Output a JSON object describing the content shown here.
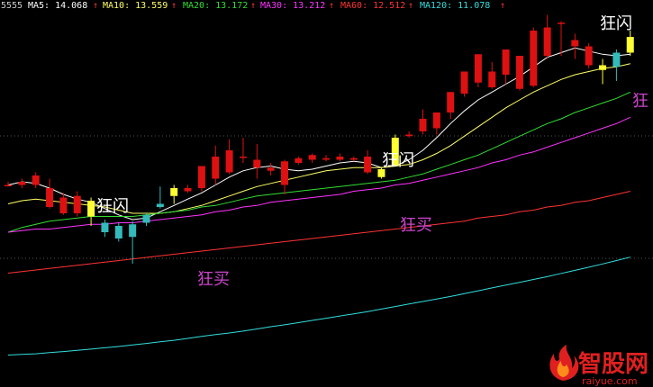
{
  "chart_data": {
    "type": "candlestick",
    "code": "5555",
    "moving_averages": [
      {
        "name": "MA5",
        "value": "14.068",
        "color": "#ffffff"
      },
      {
        "name": "MA10",
        "value": "13.559",
        "color": "#ffff66"
      },
      {
        "name": "MA20",
        "value": "13.172",
        "color": "#33dd33"
      },
      {
        "name": "MA30",
        "value": "13.212",
        "color": "#ff33ff"
      },
      {
        "name": "MA60",
        "value": "12.512",
        "color": "#ff3333"
      },
      {
        "name": "MA120",
        "value": "11.078",
        "color": "#33dddd"
      }
    ],
    "up_arrow": "↑",
    "colors": {
      "background": "#000000",
      "up": "#dd1111",
      "down": "#33bbbb",
      "signal": "#ffff33",
      "pink_annotation": "#cc44cc",
      "grid": "#555555"
    },
    "candles": [
      {
        "o": 10.0,
        "c": 10.0,
        "h": 10.1,
        "l": 9.95,
        "kind": "up"
      },
      {
        "o": 10.0,
        "c": 10.1,
        "h": 10.2,
        "l": 9.9,
        "kind": "up"
      },
      {
        "o": 10.3,
        "c": 10.0,
        "h": 10.4,
        "l": 9.9,
        "kind": "up"
      },
      {
        "o": 9.9,
        "c": 9.3,
        "h": 10.2,
        "l": 9.25,
        "kind": "up"
      },
      {
        "o": 9.6,
        "c": 9.1,
        "h": 9.75,
        "l": 9.05,
        "kind": "up"
      },
      {
        "o": 9.65,
        "c": 9.1,
        "h": 9.8,
        "l": 9.0,
        "kind": "up"
      },
      {
        "o": 9.0,
        "c": 9.5,
        "h": 9.6,
        "l": 8.7,
        "kind": "signal"
      },
      {
        "o": 8.8,
        "c": 8.5,
        "h": 8.9,
        "l": 8.35,
        "kind": "down"
      },
      {
        "o": 8.7,
        "c": 8.3,
        "h": 8.8,
        "l": 8.2,
        "kind": "down"
      },
      {
        "o": 8.75,
        "c": 8.35,
        "h": 8.85,
        "l": 7.5,
        "kind": "down"
      },
      {
        "o": 9.05,
        "c": 8.8,
        "h": 9.1,
        "l": 8.7,
        "kind": "down"
      },
      {
        "o": 9.4,
        "c": 9.3,
        "h": 9.95,
        "l": 9.25,
        "kind": "down"
      },
      {
        "o": 9.65,
        "c": 9.9,
        "h": 10.0,
        "l": 9.4,
        "kind": "signal"
      },
      {
        "o": 9.9,
        "c": 9.8,
        "h": 10.0,
        "l": 9.75,
        "kind": "up"
      },
      {
        "o": 10.6,
        "c": 9.9,
        "h": 10.6,
        "l": 9.8,
        "kind": "up"
      },
      {
        "o": 10.9,
        "c": 10.2,
        "h": 11.25,
        "l": 10.0,
        "kind": "up"
      },
      {
        "o": 11.1,
        "c": 10.4,
        "h": 11.45,
        "l": 10.35,
        "kind": "up"
      },
      {
        "o": 10.9,
        "c": 10.9,
        "h": 11.5,
        "l": 10.7,
        "kind": "up"
      },
      {
        "o": 10.8,
        "c": 10.55,
        "h": 11.3,
        "l": 10.2,
        "kind": "up"
      },
      {
        "o": 10.55,
        "c": 10.45,
        "h": 10.7,
        "l": 10.3,
        "kind": "up"
      },
      {
        "o": 10.75,
        "c": 10.0,
        "h": 10.8,
        "l": 9.7,
        "kind": "up"
      },
      {
        "o": 10.85,
        "c": 10.7,
        "h": 10.9,
        "l": 10.65,
        "kind": "up"
      },
      {
        "o": 10.95,
        "c": 10.8,
        "h": 11.0,
        "l": 10.7,
        "kind": "up"
      },
      {
        "o": 10.85,
        "c": 10.8,
        "h": 10.95,
        "l": 10.75,
        "kind": "up"
      },
      {
        "o": 10.9,
        "c": 10.8,
        "h": 11.0,
        "l": 10.75,
        "kind": "up"
      },
      {
        "o": 10.85,
        "c": 10.8,
        "h": 10.9,
        "l": 10.75,
        "kind": "up"
      },
      {
        "o": 10.9,
        "c": 10.4,
        "h": 11.1,
        "l": 10.35,
        "kind": "up"
      },
      {
        "o": 10.25,
        "c": 10.5,
        "h": 10.55,
        "l": 10.2,
        "kind": "signal"
      },
      {
        "o": 10.6,
        "c": 11.5,
        "h": 11.6,
        "l": 10.6,
        "kind": "signal"
      },
      {
        "o": 11.6,
        "c": 11.55,
        "h": 11.7,
        "l": 11.5,
        "kind": "up"
      },
      {
        "o": 12.1,
        "c": 11.7,
        "h": 12.4,
        "l": 11.6,
        "kind": "up"
      },
      {
        "o": 12.3,
        "c": 11.8,
        "h": 12.3,
        "l": 11.6,
        "kind": "up"
      },
      {
        "o": 12.95,
        "c": 12.3,
        "h": 12.95,
        "l": 12.1,
        "kind": "up"
      },
      {
        "o": 13.6,
        "c": 12.9,
        "h": 13.6,
        "l": 12.8,
        "kind": "up"
      },
      {
        "o": 14.15,
        "c": 13.25,
        "h": 14.15,
        "l": 13.1,
        "kind": "up"
      },
      {
        "o": 13.6,
        "c": 13.1,
        "h": 13.9,
        "l": 13.05,
        "kind": "up"
      },
      {
        "o": 14.3,
        "c": 13.5,
        "h": 14.3,
        "l": 13.2,
        "kind": "up"
      },
      {
        "o": 14.1,
        "c": 13.05,
        "h": 14.1,
        "l": 13.0,
        "kind": "up"
      },
      {
        "o": 14.9,
        "c": 13.15,
        "h": 15.0,
        "l": 13.1,
        "kind": "up"
      },
      {
        "o": 15.0,
        "c": 14.1,
        "h": 15.4,
        "l": 14.0,
        "kind": "up"
      },
      {
        "o": 15.15,
        "c": 15.15,
        "h": 15.2,
        "l": 14.1,
        "kind": "up"
      },
      {
        "o": 14.6,
        "c": 14.4,
        "h": 14.8,
        "l": 14.0,
        "kind": "up"
      },
      {
        "o": 14.4,
        "c": 13.8,
        "h": 14.5,
        "l": 13.7,
        "kind": "up"
      },
      {
        "o": 13.8,
        "c": 13.65,
        "h": 14.0,
        "l": 13.2,
        "kind": "signal"
      },
      {
        "o": 13.75,
        "c": 14.2,
        "h": 14.3,
        "l": 13.3,
        "kind": "down"
      },
      {
        "o": 14.2,
        "c": 14.7,
        "h": 14.9,
        "l": 14.1,
        "kind": "signal"
      }
    ],
    "ma_lines": {
      "MA5": [
        10.0,
        10.1,
        10.05,
        9.9,
        9.7,
        9.55,
        9.45,
        9.25,
        9.05,
        8.9,
        8.95,
        9.15,
        9.35,
        9.55,
        9.75,
        10.0,
        10.25,
        10.45,
        10.55,
        10.6,
        10.5,
        10.45,
        10.5,
        10.6,
        10.7,
        10.75,
        10.7,
        10.55,
        10.6,
        10.8,
        11.1,
        11.5,
        11.95,
        12.35,
        12.7,
        12.95,
        13.2,
        13.45,
        13.75,
        14.05,
        14.2,
        14.35,
        14.25,
        14.15,
        14.1,
        14.15
      ],
      "MA10": [
        9.4,
        9.5,
        9.55,
        9.5,
        9.45,
        9.4,
        9.35,
        9.3,
        9.2,
        9.1,
        9.1,
        9.1,
        9.15,
        9.25,
        9.35,
        9.5,
        9.65,
        9.8,
        9.95,
        10.05,
        10.15,
        10.25,
        10.35,
        10.45,
        10.5,
        10.55,
        10.55,
        10.55,
        10.6,
        10.65,
        10.8,
        11.0,
        11.25,
        11.55,
        11.85,
        12.15,
        12.45,
        12.7,
        12.95,
        13.15,
        13.35,
        13.5,
        13.6,
        13.7,
        13.75,
        13.85
      ],
      "MA20": [
        8.5,
        8.65,
        8.75,
        8.85,
        8.9,
        8.95,
        9.0,
        9.0,
        9.0,
        9.0,
        9.05,
        9.1,
        9.15,
        9.2,
        9.3,
        9.35,
        9.45,
        9.55,
        9.65,
        9.7,
        9.75,
        9.8,
        9.85,
        9.9,
        9.95,
        10.0,
        10.05,
        10.1,
        10.15,
        10.25,
        10.35,
        10.5,
        10.65,
        10.8,
        10.95,
        11.15,
        11.35,
        11.55,
        11.75,
        11.95,
        12.1,
        12.3,
        12.45,
        12.6,
        12.75,
        12.95
      ],
      "MA30": [
        8.5,
        8.55,
        8.6,
        8.6,
        8.65,
        8.7,
        8.75,
        8.75,
        8.8,
        8.8,
        8.85,
        8.9,
        8.95,
        9.0,
        9.05,
        9.15,
        9.2,
        9.3,
        9.35,
        9.45,
        9.5,
        9.55,
        9.6,
        9.65,
        9.7,
        9.8,
        9.85,
        9.9,
        10.0,
        10.05,
        10.15,
        10.25,
        10.35,
        10.45,
        10.55,
        10.7,
        10.8,
        10.95,
        11.05,
        11.2,
        11.35,
        11.5,
        11.65,
        11.8,
        11.95,
        12.15
      ],
      "MA60": [
        7.2,
        7.25,
        7.3,
        7.35,
        7.4,
        7.45,
        7.5,
        7.55,
        7.6,
        7.65,
        7.7,
        7.75,
        7.8,
        7.85,
        7.9,
        7.95,
        8.0,
        8.05,
        8.1,
        8.15,
        8.2,
        8.25,
        8.3,
        8.35,
        8.4,
        8.45,
        8.5,
        8.55,
        8.6,
        8.65,
        8.7,
        8.75,
        8.8,
        8.85,
        8.95,
        9.0,
        9.05,
        9.15,
        9.2,
        9.3,
        9.35,
        9.45,
        9.5,
        9.6,
        9.7,
        9.8
      ],
      "MA120": [
        4.6,
        4.62,
        4.64,
        4.68,
        4.71,
        4.75,
        4.79,
        4.83,
        4.87,
        4.92,
        4.97,
        5.02,
        5.07,
        5.13,
        5.19,
        5.25,
        5.3,
        5.36,
        5.43,
        5.5,
        5.56,
        5.63,
        5.7,
        5.77,
        5.84,
        5.91,
        5.98,
        6.06,
        6.14,
        6.22,
        6.3,
        6.38,
        6.46,
        6.55,
        6.64,
        6.73,
        6.82,
        6.91,
        7.0,
        7.09,
        7.19,
        7.29,
        7.39,
        7.49,
        7.6,
        7.71
      ]
    },
    "annotations": [
      {
        "text": "狂闪",
        "color": "#ffffff",
        "index": 6
      },
      {
        "text": "狂买",
        "color": "#cc44cc",
        "index": 12
      },
      {
        "text": "狂闪",
        "color": "#ffffff",
        "index": 28
      },
      {
        "text": "狂买",
        "color": "#cc44cc",
        "index": 28
      },
      {
        "text": "狂闪",
        "color": "#ffffff",
        "index": 44
      },
      {
        "text": "狂",
        "color": "#cc44cc",
        "index": 45
      }
    ]
  },
  "watermark": {
    "brand": "智股网",
    "url": "raiyue.com"
  }
}
